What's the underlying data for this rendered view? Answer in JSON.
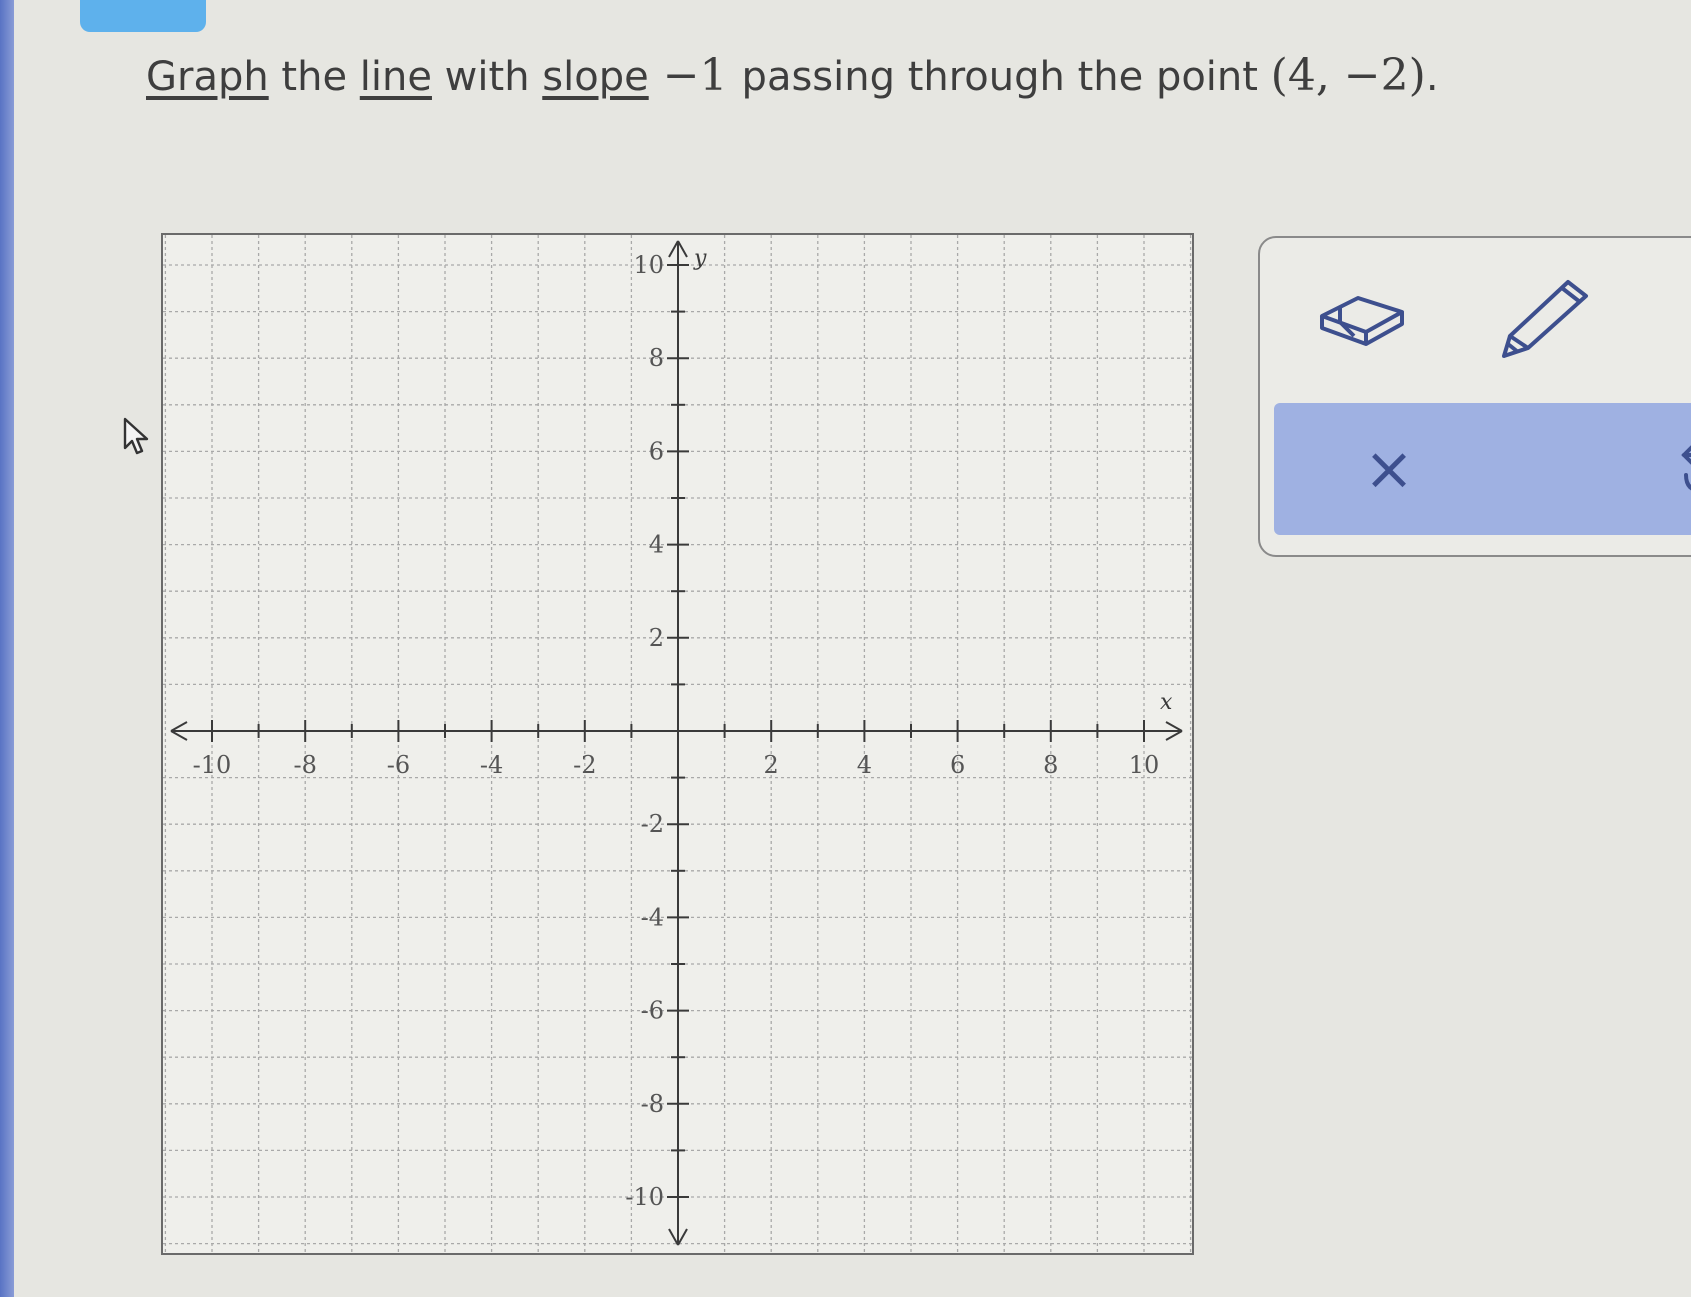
{
  "question": {
    "prefix": "",
    "word_graph": "Graph",
    "t1": " the ",
    "word_line": "line",
    "t2": " with ",
    "word_slope": "slope",
    "slope_value": " −1 ",
    "t3": "passing through the point ",
    "point": "(4, −2)",
    "end": "."
  },
  "colors": {
    "accent_tab": "#5eb1ec",
    "action_bar": "#9fb1e2",
    "icon": "#3d4f8e",
    "axis": "#3a3a3a",
    "grid": "#a9a9a9"
  },
  "tools": {
    "eraser_icon": "eraser-icon",
    "pencil_icon": "pencil-icon",
    "clear_icon": "close-icon",
    "clear_glyph": "×",
    "undo_icon": "undo-icon"
  },
  "graph": {
    "x_label": "x",
    "y_label": "y",
    "x_range": [
      -11,
      11
    ],
    "y_range": [
      -11,
      11
    ],
    "grid_step": 1,
    "label_step": 2,
    "x_tick_labels": [
      "-10",
      "-8",
      "-6",
      "-4",
      "-2",
      "2",
      "4",
      "6",
      "8",
      "10"
    ],
    "y_tick_labels": [
      "10",
      "8",
      "6",
      "4",
      "2",
      "-2",
      "-4",
      "-6",
      "-8",
      "-10"
    ]
  }
}
